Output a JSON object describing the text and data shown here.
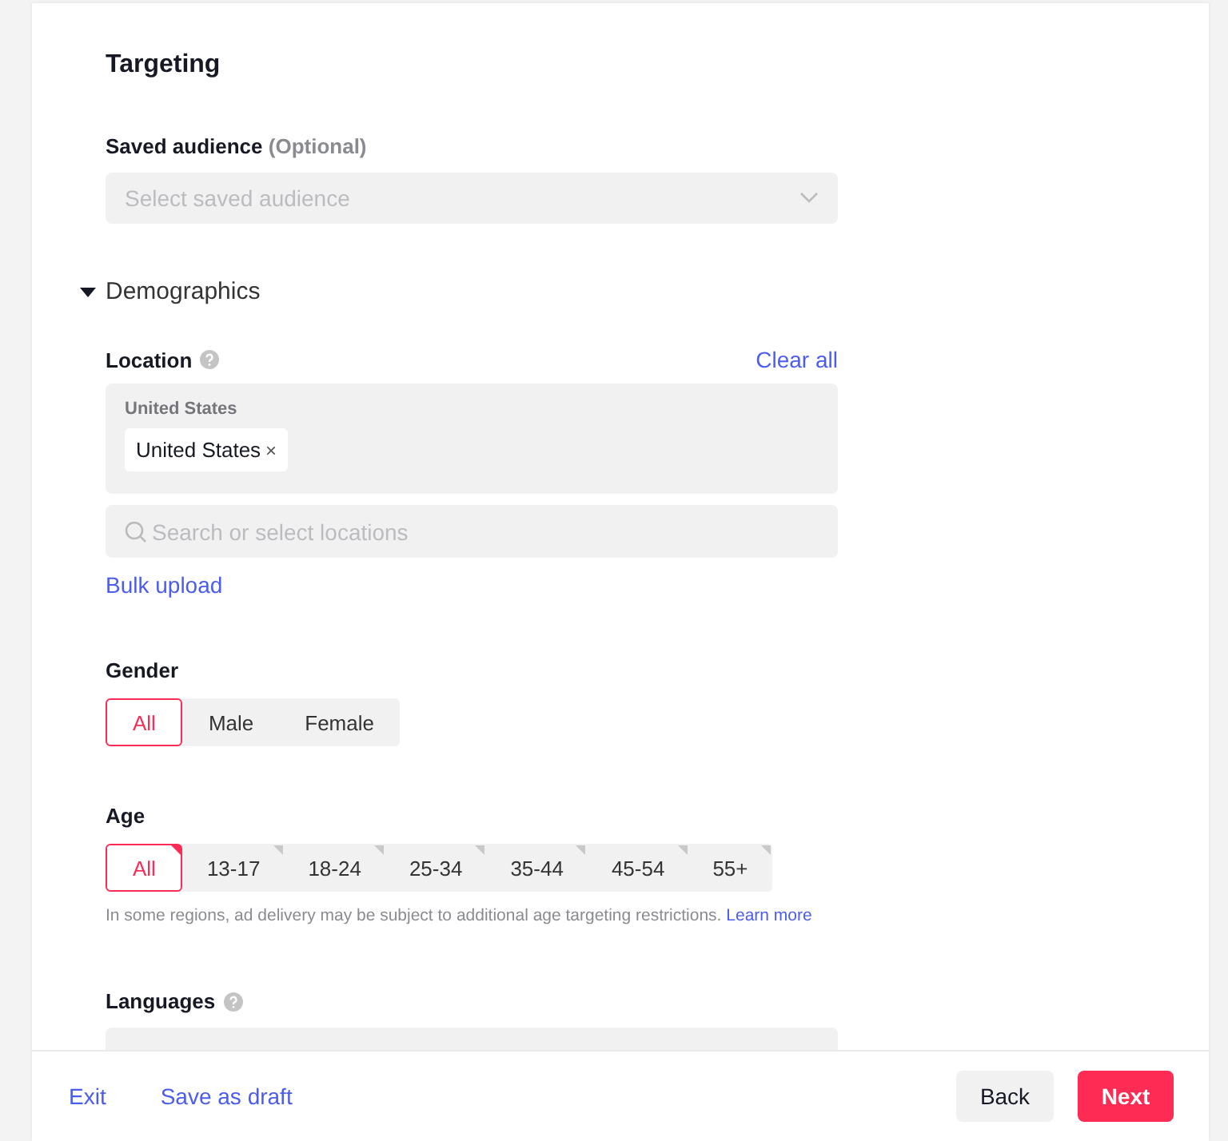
{
  "title": "Targeting",
  "saved_audience": {
    "label": "Saved audience",
    "optional": "(Optional)",
    "placeholder": "Select saved audience"
  },
  "demographics": {
    "label": "Demographics",
    "expanded": true
  },
  "location": {
    "label": "Location",
    "clear": "Clear all",
    "group": "United States",
    "tags": [
      {
        "label": "United States",
        "remove": "×"
      }
    ],
    "search_placeholder": "Search or select locations",
    "bulk": "Bulk upload"
  },
  "gender": {
    "label": "Gender",
    "options": [
      {
        "label": "All",
        "selected": true
      },
      {
        "label": "Male",
        "selected": false
      },
      {
        "label": "Female",
        "selected": false
      }
    ]
  },
  "age": {
    "label": "Age",
    "options": [
      {
        "label": "All",
        "selected": true
      },
      {
        "label": "13-17",
        "selected": false
      },
      {
        "label": "18-24",
        "selected": false
      },
      {
        "label": "25-34",
        "selected": false
      },
      {
        "label": "35-44",
        "selected": false
      },
      {
        "label": "45-54",
        "selected": false
      },
      {
        "label": "55+",
        "selected": false
      }
    ],
    "note": "In some regions, ad delivery may be subject to additional age targeting restrictions.",
    "learn_more": "Learn more"
  },
  "languages": {
    "label": "Languages"
  },
  "footer": {
    "exit": "Exit",
    "draft": "Save as draft",
    "back": "Back",
    "next": "Next"
  }
}
